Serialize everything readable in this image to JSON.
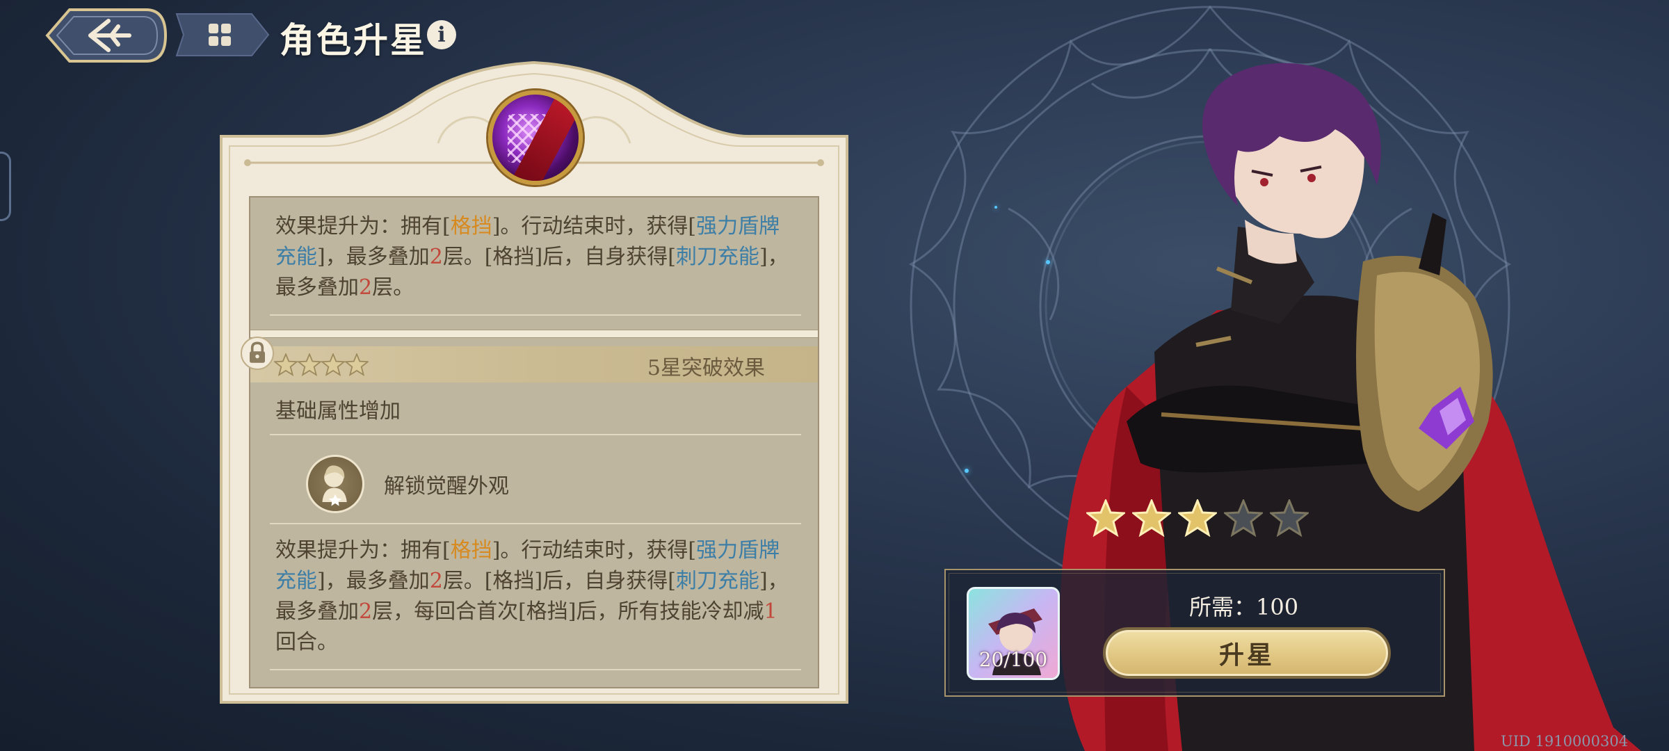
{
  "header": {
    "title": "角色升星",
    "info_icon": "i"
  },
  "card": {
    "current_effect": [
      {
        "text": "效果提升为：拥有[",
        "style": "normal"
      },
      {
        "text": "格挡",
        "style": "orange"
      },
      {
        "text": "]。行动结束时，获得[",
        "style": "normal"
      },
      {
        "text": "强力盾牌充能",
        "style": "blue"
      },
      {
        "text": "]，最多叠加",
        "style": "normal"
      },
      {
        "text": "2",
        "style": "red"
      },
      {
        "text": "层。[格挡]后，自身获得[",
        "style": "normal"
      },
      {
        "text": "刺刀充能",
        "style": "blue"
      },
      {
        "text": "]，最多叠加",
        "style": "normal"
      },
      {
        "text": "2",
        "style": "red"
      },
      {
        "text": "层。",
        "style": "normal"
      }
    ],
    "next_tier": {
      "title": "5星突破效果",
      "stars": 4,
      "locked": true
    },
    "base_attribute": "基础属性增加",
    "unlock_label": "解锁觉醒外观",
    "next_effect": [
      {
        "text": "效果提升为：拥有[",
        "style": "normal"
      },
      {
        "text": "格挡",
        "style": "orange"
      },
      {
        "text": "]。行动结束时，获得[",
        "style": "normal"
      },
      {
        "text": "强力盾牌充能",
        "style": "blue"
      },
      {
        "text": "]，最多叠加",
        "style": "normal"
      },
      {
        "text": "2",
        "style": "red"
      },
      {
        "text": "层。[格挡]后，自身获得[",
        "style": "normal"
      },
      {
        "text": "刺刀充能",
        "style": "blue"
      },
      {
        "text": "]，最多叠加",
        "style": "normal"
      },
      {
        "text": "2",
        "style": "red"
      },
      {
        "text": "层，每回合首次[格挡]后，所有技能冷却减",
        "style": "normal"
      },
      {
        "text": "1",
        "style": "red"
      },
      {
        "text": "回合。",
        "style": "normal"
      }
    ]
  },
  "rating": {
    "current_stars": 3,
    "max_stars": 5
  },
  "upgrade": {
    "required_text": "所需：100",
    "shard_count": "20/100",
    "button_label": "升星"
  },
  "footer": {
    "uid": "UID 1910000304"
  },
  "colors": {
    "orange": "#d78a1f",
    "blue": "#3d7ea6",
    "red": "#c2473a",
    "gold": "#e2c36a"
  }
}
